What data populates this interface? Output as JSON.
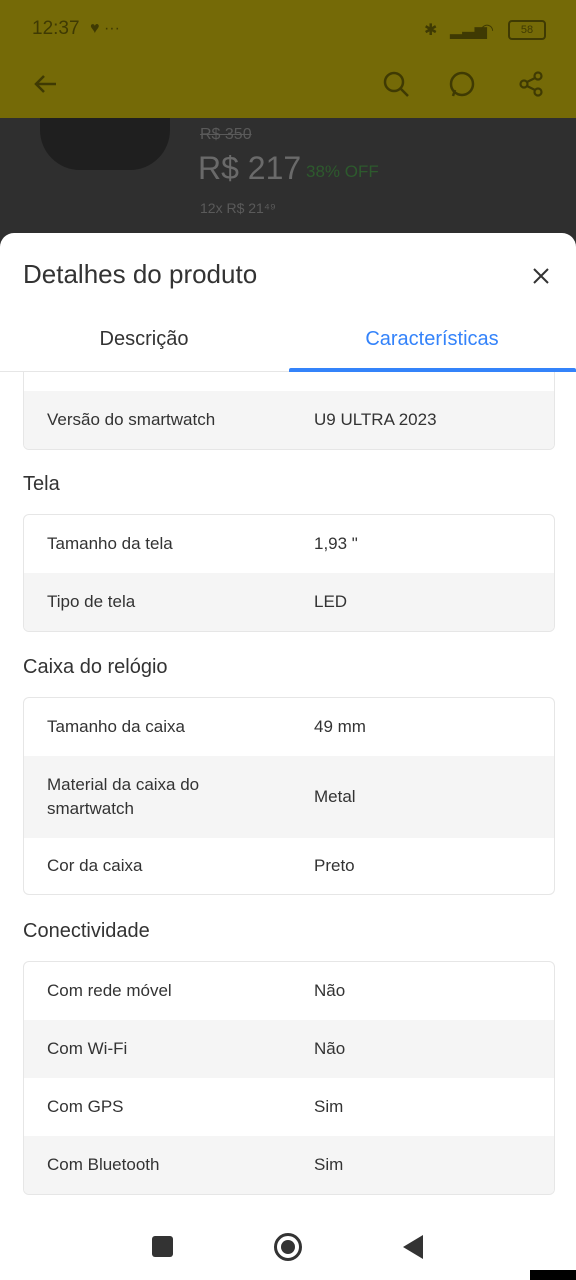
{
  "status_bar": {
    "time": "12:37",
    "battery": "58"
  },
  "background_product": {
    "old_price": "R$ 350",
    "price": "R$ 217",
    "discount": "38% OFF",
    "installments": "12x R$ 21⁴⁹"
  },
  "toolbar": {
    "icons": [
      "back-arrow-icon",
      "search-icon",
      "whatsapp-icon",
      "share-icon"
    ]
  },
  "sheet": {
    "title": "Detalhes do produto",
    "tabs": [
      {
        "label": "Descrição",
        "selected": false
      },
      {
        "label": "Características",
        "selected": true
      }
    ],
    "accent_color": "#3483fa"
  },
  "specs": {
    "first_card": {
      "rows": [
        {
          "key": "Versão do smartwatch",
          "value": "U9 ULTRA 2023"
        }
      ]
    },
    "sections": [
      {
        "title": "Tela",
        "rows": [
          {
            "key": "Tamanho da tela",
            "value": "1,93 \""
          },
          {
            "key": "Tipo de tela",
            "value": "LED"
          }
        ]
      },
      {
        "title": "Caixa do relógio",
        "rows": [
          {
            "key": "Tamanho da caixa",
            "value": "49 mm"
          },
          {
            "key": "Material da caixa do smartwatch",
            "value": "Metal"
          },
          {
            "key": "Cor da caixa",
            "value": "Preto"
          }
        ]
      },
      {
        "title": "Conectividade",
        "rows": [
          {
            "key": "Com rede móvel",
            "value": "Não"
          },
          {
            "key": "Com Wi-Fi",
            "value": "Não"
          },
          {
            "key": "Com GPS",
            "value": "Sim"
          },
          {
            "key": "Com Bluetooth",
            "value": "Sim"
          }
        ]
      }
    ]
  },
  "nav_bar": {
    "buttons": [
      "recents-button",
      "home-button",
      "back-button"
    ]
  }
}
